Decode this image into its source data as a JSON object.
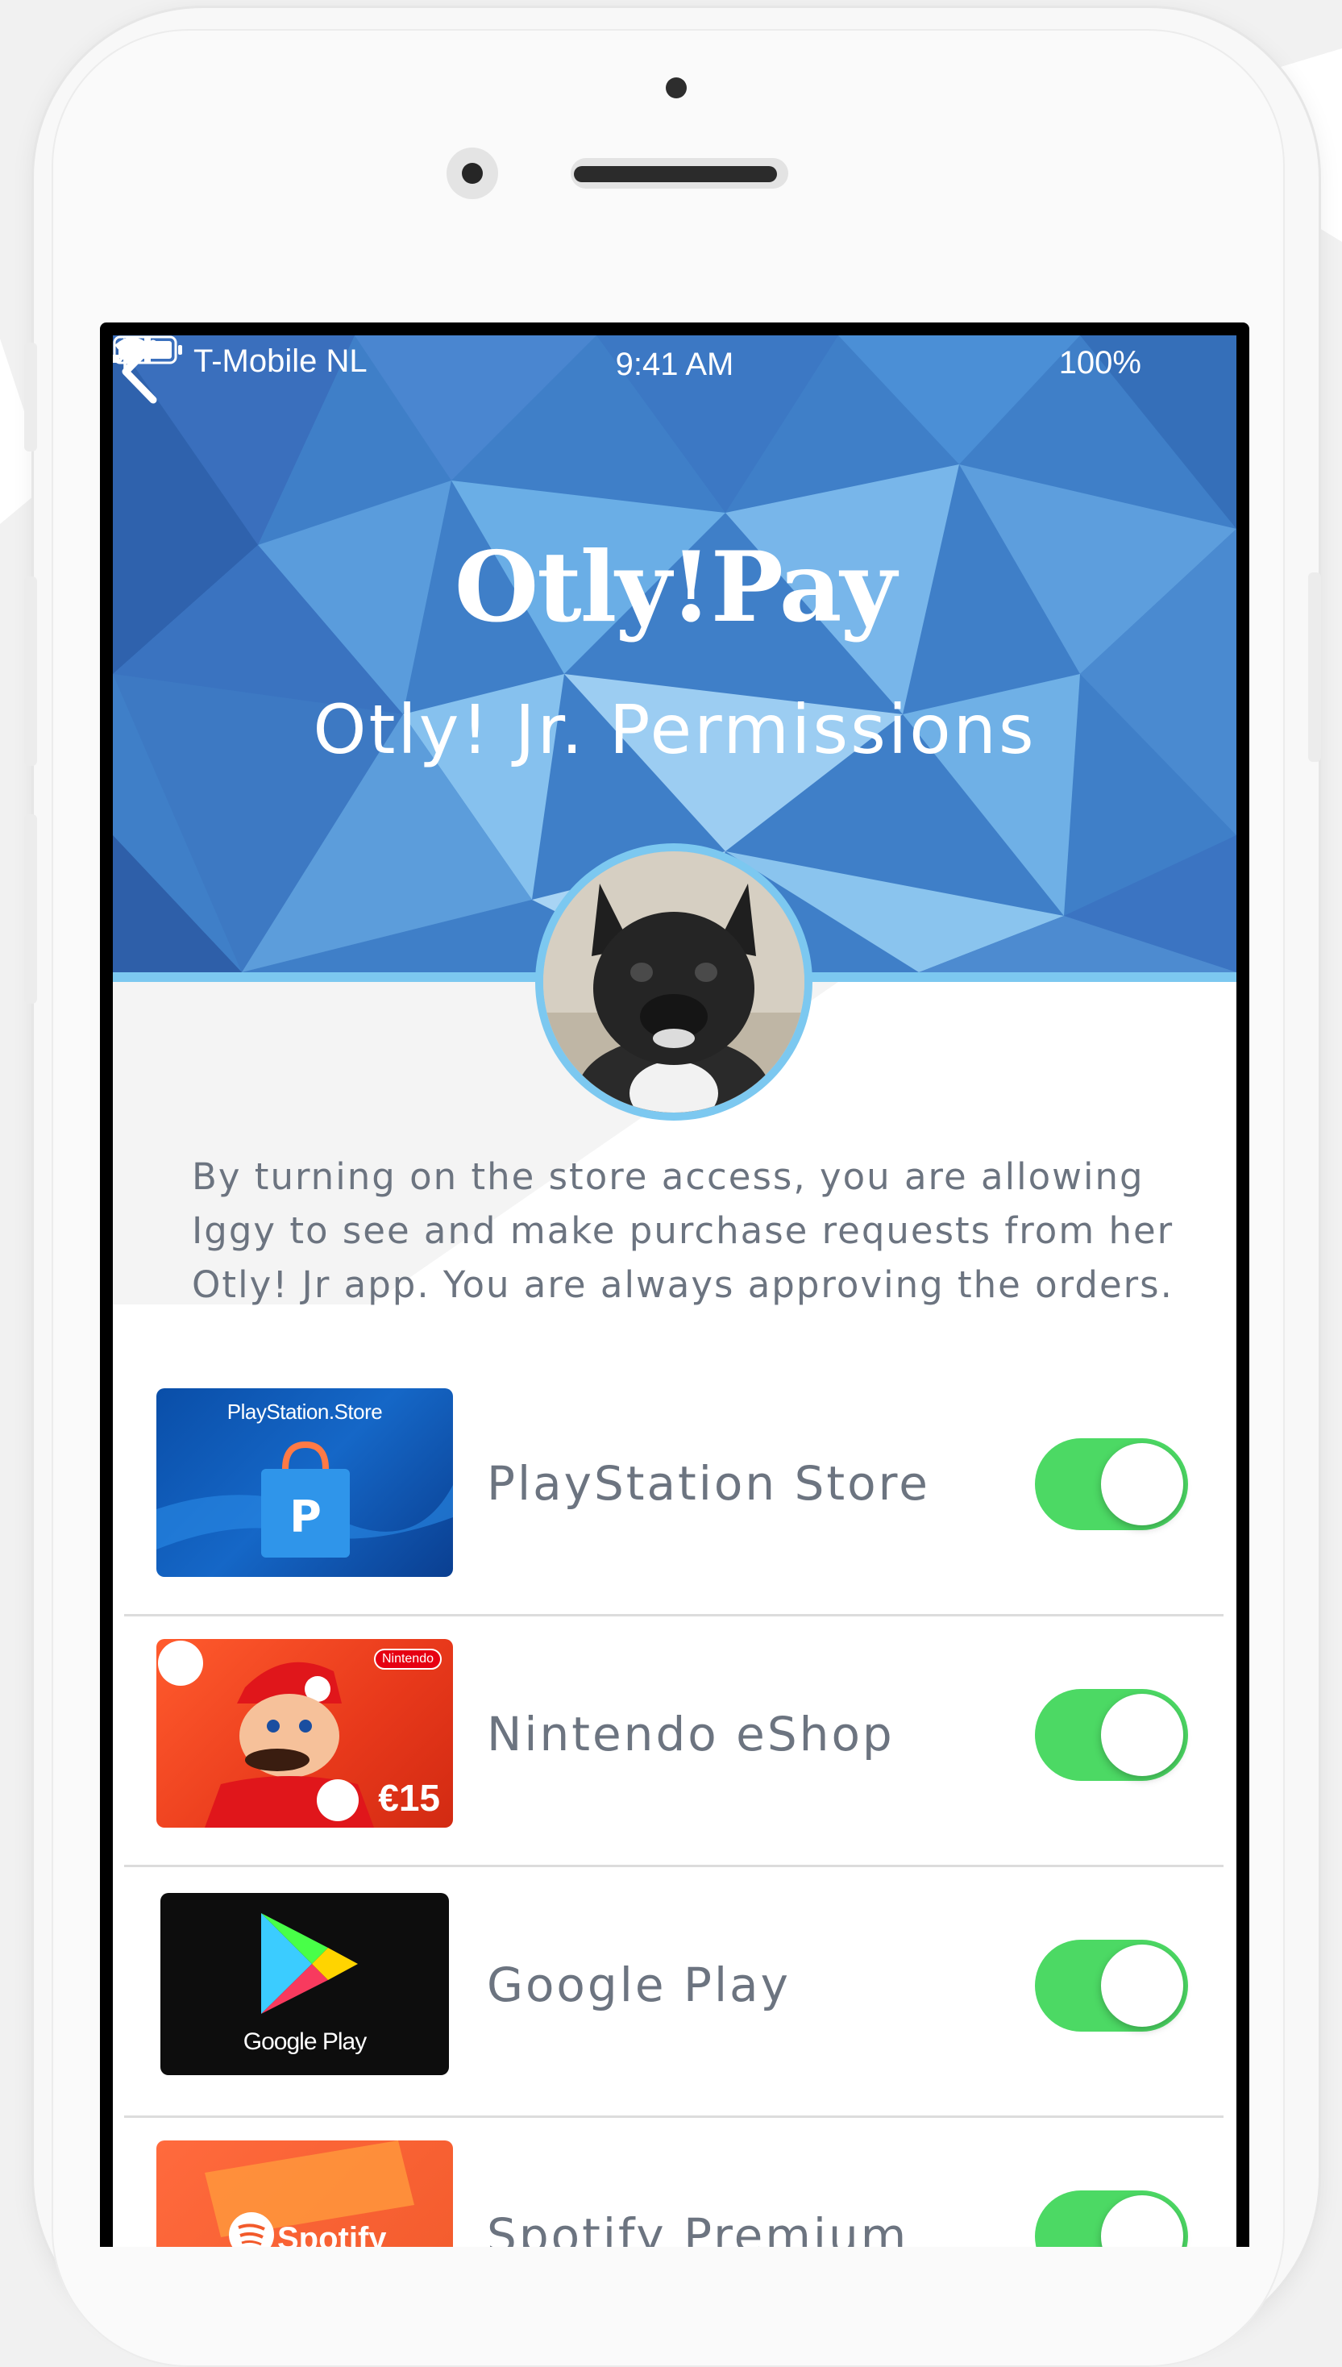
{
  "status_bar": {
    "carrier": "T-Mobile NL",
    "time": "9:41 AM",
    "battery": "100%"
  },
  "header": {
    "logo_text": "Otly!Pay",
    "title": "Otly! Jr. Permissions"
  },
  "description": "By turning on the store access, you are allowing Iggy to see and make purchase requests from her Otly! Jr app. You are always approving the orders.",
  "stores": [
    {
      "name": "PlayStation Store",
      "enabled": true,
      "card_text": "PlayStation.Store"
    },
    {
      "name": "Nintendo eShop",
      "enabled": true,
      "card_badge": "Nintendo",
      "card_price": "€15"
    },
    {
      "name": "Google Play",
      "enabled": true,
      "card_text": "Google Play"
    },
    {
      "name": "Spotify Premium",
      "enabled": true,
      "card_text": "Spotify"
    }
  ],
  "colors": {
    "header_blue": "#3f7fc8",
    "accent_light_blue": "#7cc8f0",
    "toggle_on": "#4cd964",
    "text_gray": "#6c7480"
  }
}
